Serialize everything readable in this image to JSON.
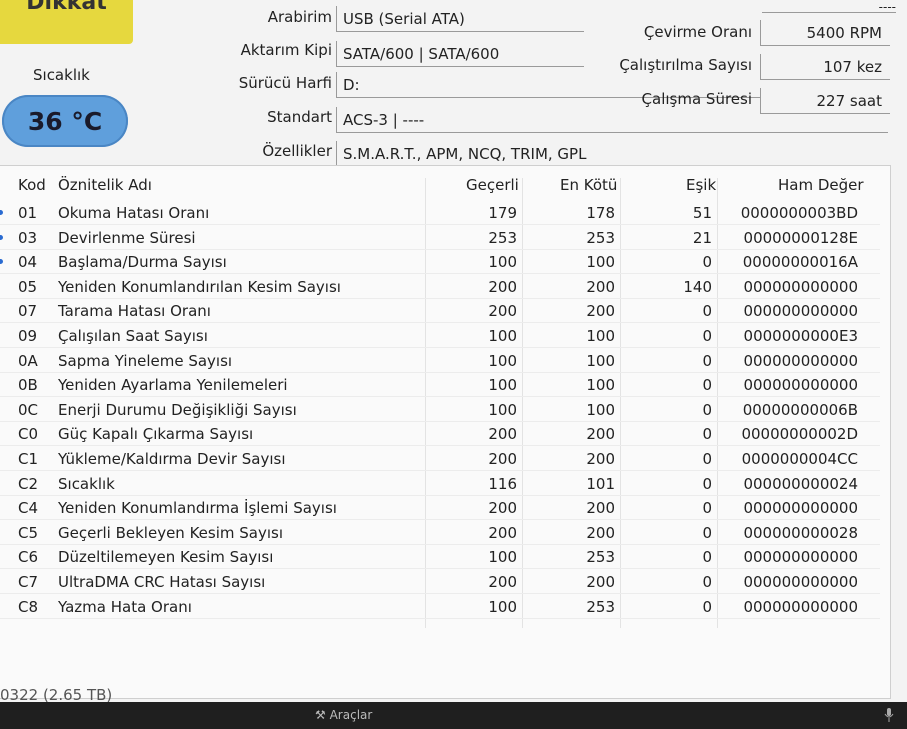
{
  "status": "Dikkat",
  "temperature": {
    "label": "Sıcaklık",
    "value": "36 °C"
  },
  "top_right_dashes": "----",
  "info_left": [
    {
      "label": "Arabirim",
      "value": "USB (Serial ATA)"
    },
    {
      "label": "Aktarım Kipi",
      "value": "SATA/600 | SATA/600"
    },
    {
      "label": "Sürücü Harfi",
      "value": "D:"
    },
    {
      "label": "Standart",
      "value": "ACS-3 | ----"
    },
    {
      "label": "Özellikler",
      "value": "S.M.A.R.T., APM, NCQ, TRIM, GPL"
    }
  ],
  "info_right": [
    {
      "label": "Çevirme Oranı",
      "value": "5400 RPM"
    },
    {
      "label": "Çalıştırılma Sayısı",
      "value": "107 kez"
    },
    {
      "label": "Çalışma Süresi",
      "value": "227 saat"
    }
  ],
  "table": {
    "headers": {
      "id": "Kod",
      "name": "Öznitelik Adı",
      "current": "Geçerli",
      "worst": "En Kötü",
      "threshold": "Eşik",
      "raw": "Ham Değer"
    },
    "rows": [
      {
        "id": "01",
        "name": "Okuma Hatası Oranı",
        "current": "179",
        "worst": "178",
        "threshold": "51",
        "raw": "0000000003BD"
      },
      {
        "id": "03",
        "name": "Devirlenme Süresi",
        "current": "253",
        "worst": "253",
        "threshold": "21",
        "raw": "00000000128E"
      },
      {
        "id": "04",
        "name": "Başlama/Durma Sayısı",
        "current": "100",
        "worst": "100",
        "threshold": "0",
        "raw": "00000000016A"
      },
      {
        "id": "05",
        "name": "Yeniden Konumlandırılan Kesim Sayısı",
        "current": "200",
        "worst": "200",
        "threshold": "140",
        "raw": "000000000000"
      },
      {
        "id": "07",
        "name": "Tarama Hatası Oranı",
        "current": "200",
        "worst": "200",
        "threshold": "0",
        "raw": "000000000000"
      },
      {
        "id": "09",
        "name": "Çalışılan Saat Sayısı",
        "current": "100",
        "worst": "100",
        "threshold": "0",
        "raw": "0000000000E3"
      },
      {
        "id": "0A",
        "name": "Sapma Yineleme Sayısı",
        "current": "100",
        "worst": "100",
        "threshold": "0",
        "raw": "000000000000"
      },
      {
        "id": "0B",
        "name": "Yeniden Ayarlama Yenilemeleri",
        "current": "100",
        "worst": "100",
        "threshold": "0",
        "raw": "000000000000"
      },
      {
        "id": "0C",
        "name": "Enerji Durumu Değişikliği Sayısı",
        "current": "100",
        "worst": "100",
        "threshold": "0",
        "raw": "00000000006B"
      },
      {
        "id": "C0",
        "name": "Güç Kapalı Çıkarma Sayısı",
        "current": "200",
        "worst": "200",
        "threshold": "0",
        "raw": "00000000002D"
      },
      {
        "id": "C1",
        "name": "Yükleme/Kaldırma Devir Sayısı",
        "current": "200",
        "worst": "200",
        "threshold": "0",
        "raw": "0000000004CC"
      },
      {
        "id": "C2",
        "name": "Sıcaklık",
        "current": "116",
        "worst": "101",
        "threshold": "0",
        "raw": "000000000024"
      },
      {
        "id": "C4",
        "name": "Yeniden Konumlandırma İşlemi Sayısı",
        "current": "200",
        "worst": "200",
        "threshold": "0",
        "raw": "000000000000"
      },
      {
        "id": "C5",
        "name": "Geçerli Bekleyen Kesim Sayısı",
        "current": "200",
        "worst": "200",
        "threshold": "0",
        "raw": "000000000028"
      },
      {
        "id": "C6",
        "name": "Düzeltilemeyen Kesim Sayısı",
        "current": "100",
        "worst": "253",
        "threshold": "0",
        "raw": "000000000000"
      },
      {
        "id": "C7",
        "name": "UltraDMA CRC Hatası Sayısı",
        "current": "200",
        "worst": "200",
        "threshold": "0",
        "raw": "000000000000"
      },
      {
        "id": "C8",
        "name": "Yazma Hata Oranı",
        "current": "100",
        "worst": "253",
        "threshold": "0",
        "raw": "000000000000"
      }
    ]
  },
  "bottom_partial": "0322 (2.65 TB)",
  "taskbar": {
    "tools_label": "Araçlar"
  },
  "colors": {
    "warning": "#e6d83e",
    "temp": "#5f9fdc",
    "dot": "#2a6bd1"
  }
}
